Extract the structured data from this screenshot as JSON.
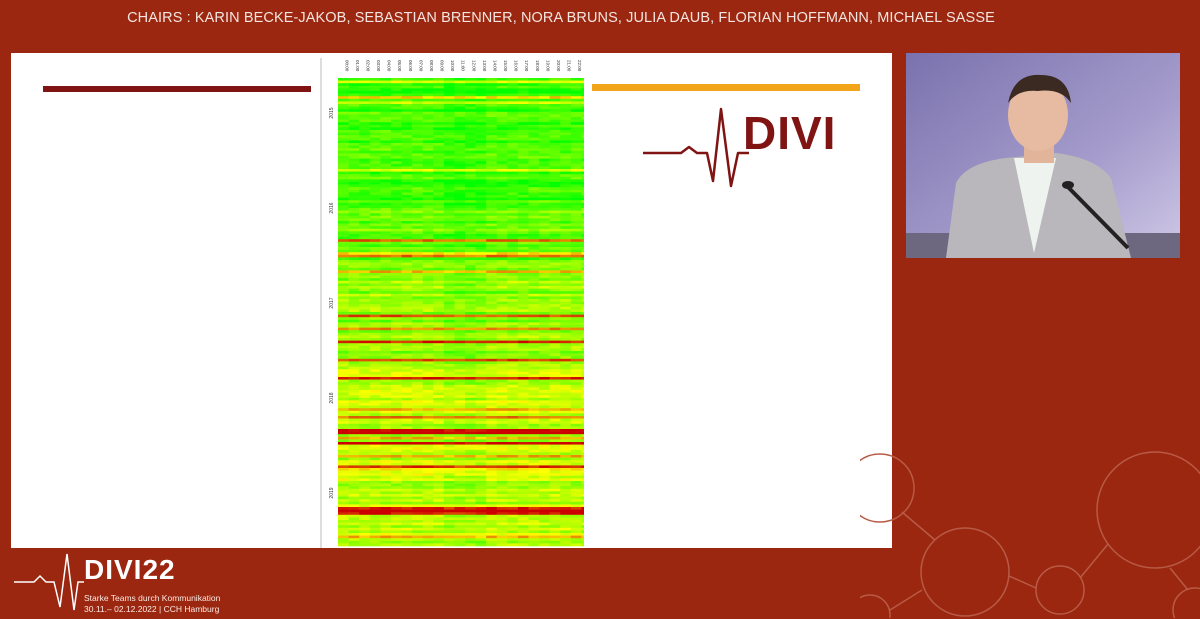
{
  "header": {
    "chairs": "CHAIRS : KARIN BECKE-JAKOB, SEBASTIAN BRENNER, NORA BRUNS, JULIA DAUB, FLORIAN HOFFMANN, MICHAEL SASSE"
  },
  "slide": {
    "logo_word": "DIVI",
    "colors": {
      "bar_left": "#7f1413",
      "bar_right": "#f2a51a",
      "brand_red": "#7f1413"
    }
  },
  "chart_data": {
    "type": "heatmap",
    "x_labels": [
      "00:00",
      "01:00",
      "02:00",
      "03:00",
      "04:00",
      "05:00",
      "06:00",
      "07:00",
      "08:00",
      "09:00",
      "10:00",
      "11:00",
      "12:00",
      "13:00",
      "14:00",
      "15:00",
      "16:00",
      "17:00",
      "18:00",
      "19:00",
      "20:00",
      "21:00",
      "22:00",
      "23:00"
    ],
    "y_labels": [
      "2015",
      "2016",
      "2017",
      "2018",
      "2019"
    ],
    "color_scale": [
      "#00ff00",
      "#ffff00",
      "#cc0000"
    ]
  },
  "video": {
    "speaker_icon": "speaker-video-feed"
  },
  "footer": {
    "event": "DIVI22",
    "tagline": "Starke Teams durch Kommunikation",
    "dates": "30.11.– 02.12.2022 | CCH Hamburg"
  }
}
